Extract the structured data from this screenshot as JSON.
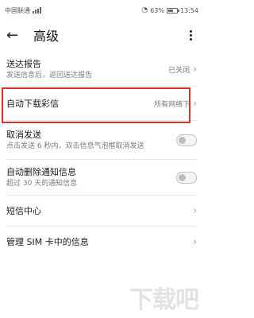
{
  "status": {
    "carrier": "中国联通",
    "battery_percent": "63%",
    "time": "13:54",
    "battery_level": 0.63
  },
  "header": {
    "title": "高级"
  },
  "items": [
    {
      "title": "送达报告",
      "subtitle": "发送信息后，返回送达报告",
      "value": "已关闭"
    },
    {
      "title": "自动下载彩信",
      "value": "所有网络下"
    },
    {
      "title": "取消发送",
      "subtitle": "点击发送 6 秒内，双击信息气泡框取消发送",
      "toggle_on": false
    },
    {
      "title": "自动删除通知信息",
      "subtitle": "超过 30 天的通知信息",
      "toggle_on": false
    },
    {
      "title": "短信中心"
    },
    {
      "title": "管理 SIM 卡中的信息"
    }
  ],
  "watermark": "下载吧",
  "colors": {
    "highlight": "#d9302a"
  }
}
